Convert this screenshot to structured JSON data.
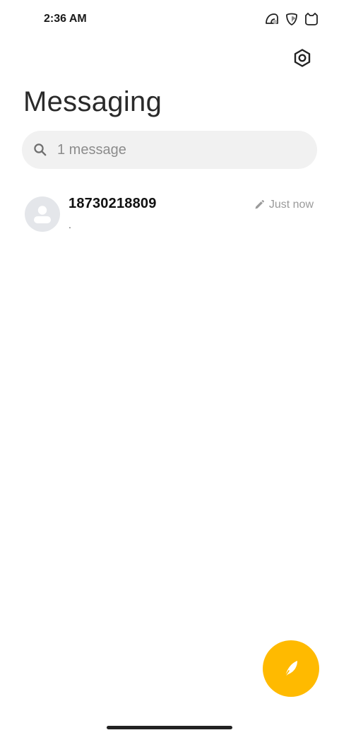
{
  "status_bar": {
    "time": "2:36 AM",
    "icons": [
      "notification-app-icon",
      "shield-app-icon",
      "cat-app-icon"
    ]
  },
  "header": {
    "title": "Messaging",
    "settings_icon": "gear-icon"
  },
  "search": {
    "placeholder": "1 message",
    "value": "",
    "icon": "search-icon"
  },
  "conversations": [
    {
      "name": "18730218809",
      "preview": ".",
      "time": "Just now",
      "draft_icon": "pencil-icon",
      "avatar_icon": "person-icon"
    }
  ],
  "fab": {
    "icon": "compose-quill-icon",
    "color": "#ffba00"
  },
  "colors": {
    "accent": "#ffba00",
    "search_background": "#f1f1f1",
    "avatar_background": "#e4e6ea"
  }
}
